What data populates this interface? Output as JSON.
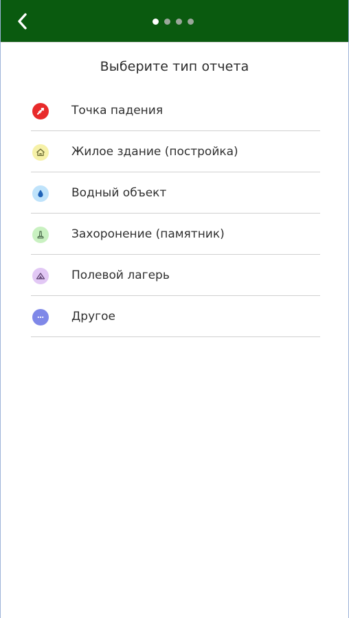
{
  "header": {
    "pager": {
      "count": 4,
      "active_index": 0
    },
    "background_color": "#0a5a0f"
  },
  "main": {
    "title": "Выберите тип отчета"
  },
  "report_types": [
    {
      "label": "Точка падения",
      "icon": "crash-point-icon",
      "icon_color": "#e82a2a"
    },
    {
      "label": "Жилое здание (постройка)",
      "icon": "house-icon",
      "icon_color": "#f6f1a8"
    },
    {
      "label": "Водный объект",
      "icon": "water-drop-icon",
      "icon_color": "#bfe3fb"
    },
    {
      "label": "Захоронение (памятник)",
      "icon": "monument-icon",
      "icon_color": "#c9f1c1"
    },
    {
      "label": "Полевой лагерь",
      "icon": "field-camp-icon",
      "icon_color": "#e2c8f5"
    },
    {
      "label": "Другое",
      "icon": "more-icon",
      "icon_color": "#7f88e8"
    }
  ]
}
